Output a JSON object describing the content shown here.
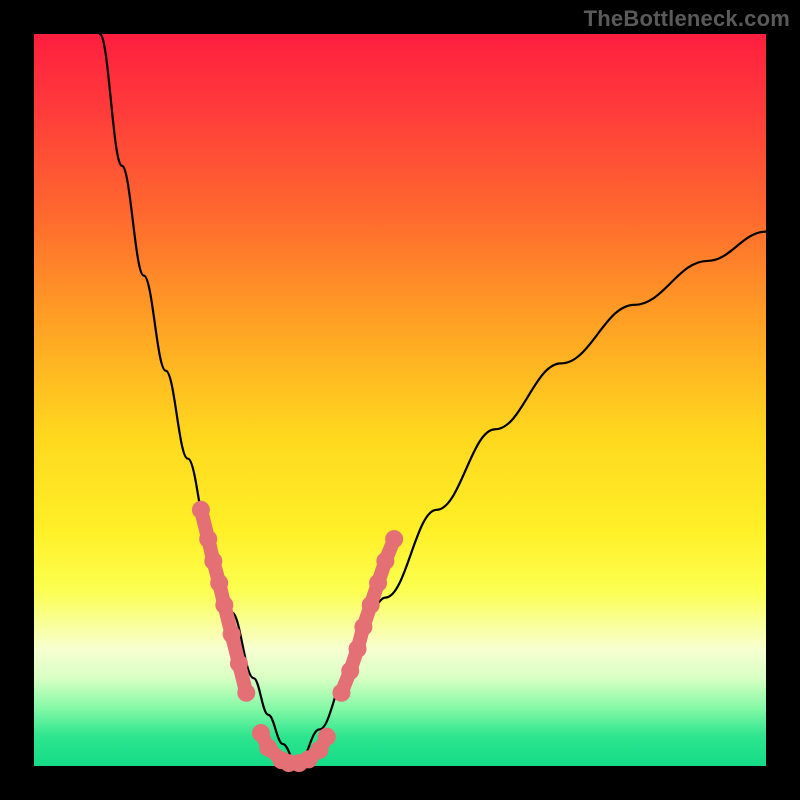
{
  "watermark": "TheBottleneck.com",
  "chart_data": {
    "type": "line",
    "title": "",
    "xlabel": "",
    "ylabel": "",
    "xlim": [
      0,
      100
    ],
    "ylim": [
      0,
      100
    ],
    "grid": false,
    "legend_position": "none",
    "series": [
      {
        "name": "bottleneck-curve-left",
        "color": "#000000",
        "x": [
          9,
          12,
          15,
          18,
          21,
          24,
          27,
          30,
          32,
          34,
          36
        ],
        "y": [
          100,
          82,
          67,
          54,
          42,
          31,
          21,
          12,
          7,
          3,
          0
        ]
      },
      {
        "name": "bottleneck-curve-right",
        "color": "#000000",
        "x": [
          36,
          39,
          43,
          48,
          55,
          63,
          72,
          82,
          92,
          100
        ],
        "y": [
          0,
          5,
          13,
          23,
          35,
          46,
          55,
          63,
          69,
          73
        ]
      },
      {
        "name": "left-highlight-dots",
        "color": "#e46f75",
        "x": [
          22.8,
          23.8,
          24.5,
          25.3,
          26.0,
          27.0,
          28.0,
          29.0
        ],
        "y": [
          35,
          31,
          28,
          25,
          22,
          18,
          14,
          10
        ]
      },
      {
        "name": "floor-highlight-dots",
        "color": "#e46f75",
        "x": [
          31.0,
          32.0,
          33.8,
          34.8,
          36.2,
          37.5,
          39.0,
          40.0
        ],
        "y": [
          4.5,
          2.5,
          0.8,
          0.4,
          0.4,
          0.9,
          2.2,
          4.0
        ]
      },
      {
        "name": "right-highlight-dots",
        "color": "#e46f75",
        "x": [
          42.0,
          43.2,
          44.2,
          45.0,
          46.0,
          47.0,
          48.0,
          49.2
        ],
        "y": [
          10,
          13,
          16,
          19,
          22,
          25,
          28,
          31
        ]
      }
    ],
    "background_gradient": {
      "top": "#ff1f3f",
      "mid1": "#ffa324",
      "mid2": "#fff028",
      "pale": "#f7ffd0",
      "bottom": "#14db87"
    }
  }
}
